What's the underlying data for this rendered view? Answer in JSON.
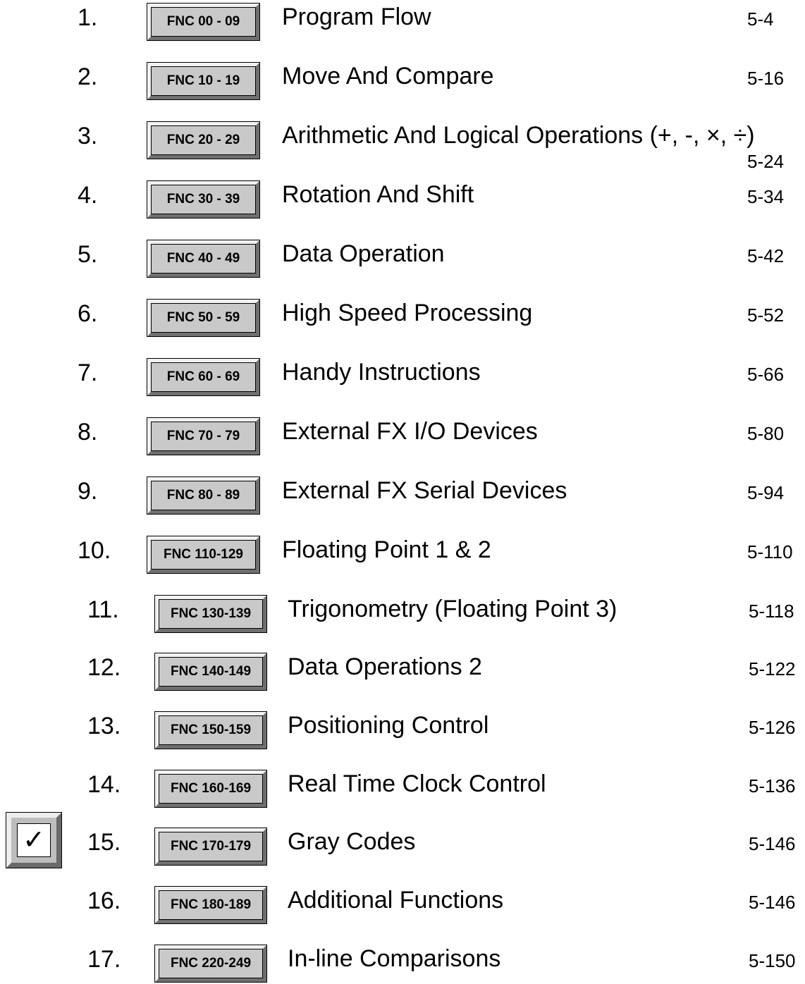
{
  "rows": [
    {
      "number": "1.",
      "key": "FNC 00 - 09",
      "title": "Program Flow",
      "page": "5-4"
    },
    {
      "number": "2.",
      "key": "FNC 10 - 19",
      "title": "Move And Compare",
      "page": "5-16"
    },
    {
      "number": "3.",
      "key": "FNC 20 - 29",
      "title": "Arithmetic And Logical Operations (+, -, ×, ÷)",
      "page": "5-24"
    },
    {
      "number": "4.",
      "key": "FNC 30 - 39",
      "title": "Rotation And Shift",
      "page": "5-34"
    },
    {
      "number": "5.",
      "key": "FNC 40 - 49",
      "title": "Data Operation",
      "page": "5-42"
    },
    {
      "number": "6.",
      "key": "FNC 50 - 59",
      "title": "High Speed Processing",
      "page": "5-52"
    },
    {
      "number": "7.",
      "key": "FNC 60 - 69",
      "title": "Handy Instructions",
      "page": "5-66"
    },
    {
      "number": "8.",
      "key": "FNC 70 - 79",
      "title": "External FX I/O Devices",
      "page": "5-80"
    },
    {
      "number": "9.",
      "key": "FNC 80 - 89",
      "title": "External FX Serial Devices",
      "page": "5-94"
    },
    {
      "number": "10.",
      "key": "FNC 110-129",
      "title": "Floating Point 1 & 2",
      "page": "5-110"
    },
    {
      "number": "11.",
      "key": "FNC 130-139",
      "title": "Trigonometry (Floating Point 3)",
      "page": "5-118"
    },
    {
      "number": "12.",
      "key": "FNC 140-149",
      "title": "Data Operations 2",
      "page": "5-122"
    },
    {
      "number": "13.",
      "key": "FNC 150-159",
      "title": "Positioning Control",
      "page": "5-126"
    },
    {
      "number": "14.",
      "key": "FNC 160-169",
      "title": "Real Time Clock Control",
      "page": "5-136"
    },
    {
      "number": "15.",
      "key": "FNC 170-179",
      "title": "Gray Codes",
      "page": "5-146"
    },
    {
      "number": "16.",
      "key": "FNC 180-189",
      "title": "Additional Functions",
      "page": "5-146"
    },
    {
      "number": "17.",
      "key": "FNC 220-249",
      "title": "In-line Comparisons",
      "page": "5-150"
    }
  ],
  "checkmark": {
    "glyph": "✓",
    "icon": "checkmark-icon",
    "row": "15."
  }
}
